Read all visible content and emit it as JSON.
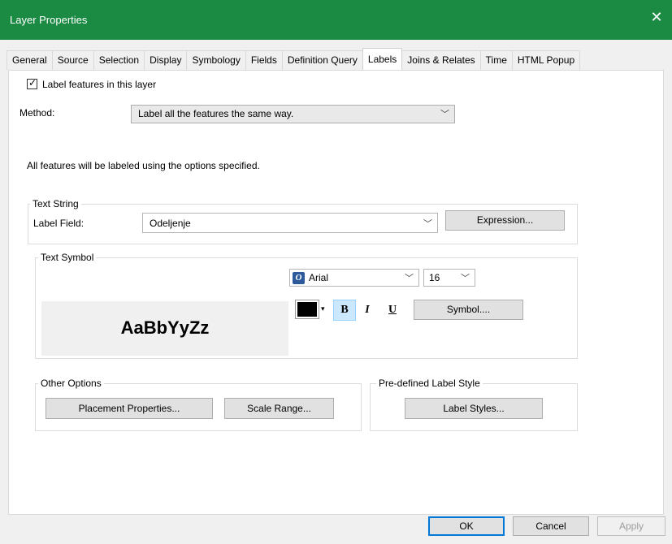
{
  "window": {
    "title": "Layer Properties",
    "close_glyph": "✕"
  },
  "tabs": [
    {
      "label": "General"
    },
    {
      "label": "Source"
    },
    {
      "label": "Selection"
    },
    {
      "label": "Display"
    },
    {
      "label": "Symbology"
    },
    {
      "label": "Fields"
    },
    {
      "label": "Definition Query"
    },
    {
      "label": "Labels",
      "active": true
    },
    {
      "label": "Joins & Relates"
    },
    {
      "label": "Time"
    },
    {
      "label": "HTML Popup"
    }
  ],
  "labels_tab": {
    "label_features_checkbox": {
      "label": "Label features in this layer",
      "checked": true
    },
    "method": {
      "label": "Method:",
      "value": "Label all the features the same way."
    },
    "info_text": "All features will be labeled using the options specified.",
    "text_string": {
      "group_title": "Text String",
      "field_label": "Label Field:",
      "field_value": "Odeljenje",
      "expression_button": "Expression..."
    },
    "text_symbol": {
      "group_title": "Text Symbol",
      "sample_text": "AaBbYyZz",
      "font_name": "Arial",
      "font_size": "16",
      "color": "#000000",
      "bold_label": "B",
      "italic_label": "I",
      "underline_label": "U",
      "bold_pressed": true,
      "symbol_button": "Symbol...."
    },
    "other_options": {
      "group_title": "Other Options",
      "placement_button": "Placement Properties...",
      "scale_button": "Scale Range..."
    },
    "predefined": {
      "group_title": "Pre-defined Label Style",
      "label_styles_button": "Label Styles..."
    }
  },
  "footer": {
    "ok": "OK",
    "cancel": "Cancel",
    "apply": "Apply"
  },
  "colors": {
    "titlebar": "#1b8a43",
    "selected_button": "#cce8ff"
  }
}
